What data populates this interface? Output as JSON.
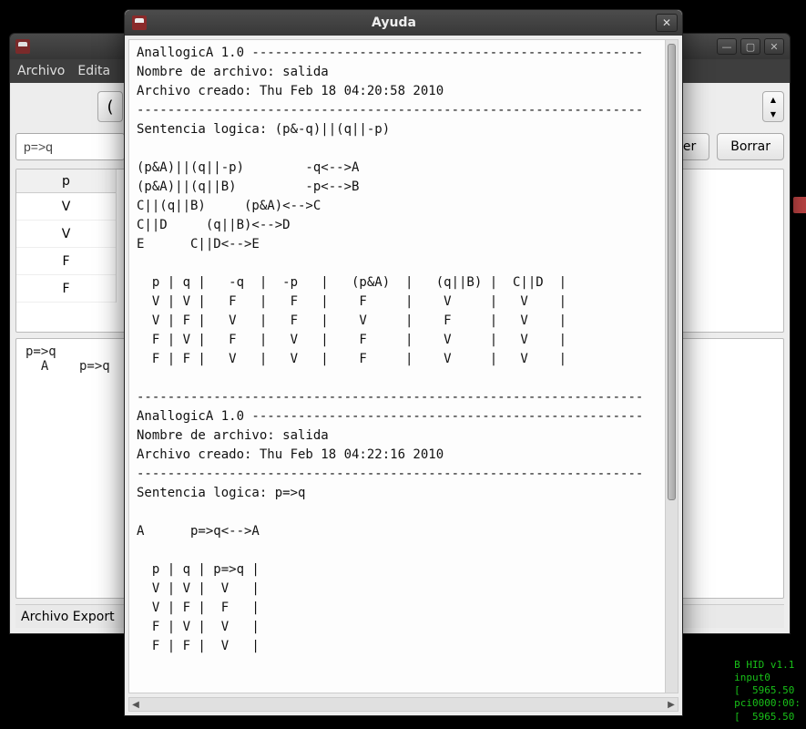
{
  "main_window": {
    "menu": {
      "archivo": "Archivo",
      "editar": "Edita"
    },
    "paren_btn": "(",
    "formula_value": "p=>q",
    "actions": {
      "truncated": "er",
      "borrar": "Borrar"
    },
    "truth_table": {
      "header": "p",
      "rows": [
        "V",
        "V",
        "F",
        "F"
      ]
    },
    "result": "p=>q\n  A    p=>q",
    "export_bar": "Archivo Export"
  },
  "help_window": {
    "title": "Ayuda",
    "content": "AnallogicA 1.0 ---------------------------------------------------\nNombre de archivo: salida\nArchivo creado: Thu Feb 18 04:20:58 2010\n------------------------------------------------------------------\nSentencia logica: (p&-q)||(q||-p)\n\n(p&A)||(q||-p)        -q<-->A\n(p&A)||(q||B)         -p<-->B\nC||(q||B)     (p&A)<-->C\nC||D     (q||B)<-->D\nE      C||D<-->E\n\n  p | q |   -q  |  -p   |   (p&A)  |   (q||B) |  C||D  |\n  V | V |   F   |   F   |    F     |    V     |   V    |\n  V | F |   V   |   F   |    V     |    F     |   V    |\n  F | V |   F   |   V   |    F     |    V     |   V    |\n  F | F |   V   |   V   |    F     |    V     |   V    |\n\n------------------------------------------------------------------\nAnallogicA 1.0 ---------------------------------------------------\nNombre de archivo: salida\nArchivo creado: Thu Feb 18 04:22:16 2010\n------------------------------------------------------------------\nSentencia logica: p=>q\n\nA      p=>q<-->A\n\n  p | q | p=>q |\n  V | V |  V   |\n  V | F |  F   |\n  F | V |  V   |\n  F | F |  V   |"
  },
  "terminal": "B HID v1.1\ninput0\n[  5965.50\npci0000:00:\n[  5965.50"
}
